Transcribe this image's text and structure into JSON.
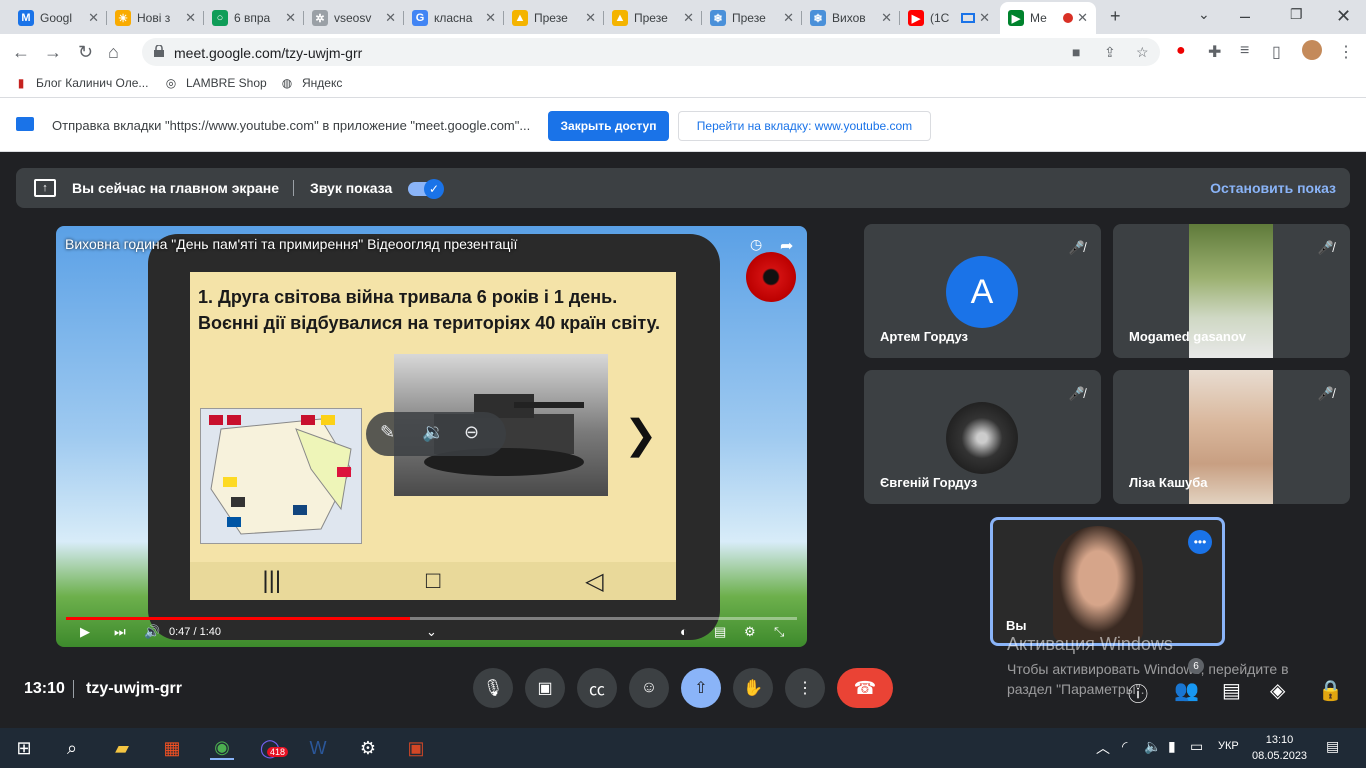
{
  "browser": {
    "tabs": [
      {
        "label": "Googl",
        "color": "#1a73e8",
        "icon": "gmail-icon",
        "glyph": "M"
      },
      {
        "label": "Нові з",
        "color": "#f9ab00",
        "icon": "sun-icon",
        "glyph": "☀"
      },
      {
        "label": "6 впра",
        "color": "#0f9d58",
        "icon": "circle-icon",
        "glyph": "○"
      },
      {
        "label": "vseosv",
        "color": "#9aa0a6",
        "icon": "star-icon",
        "glyph": "✲"
      },
      {
        "label": "класна",
        "color": "#4285f4",
        "icon": "google-icon",
        "glyph": "G"
      },
      {
        "label": "Презе",
        "color": "#f4b400",
        "icon": "slides-icon",
        "glyph": "▲"
      },
      {
        "label": "Презе",
        "color": "#f4b400",
        "icon": "slides-icon",
        "glyph": "▲"
      },
      {
        "label": "Презе",
        "color": "#4a90d9",
        "icon": "snowflake-icon",
        "glyph": "❄"
      },
      {
        "label": "Вихов",
        "color": "#4a90d9",
        "icon": "snowflake-icon",
        "glyph": "❄"
      },
      {
        "label": "(1С",
        "color": "#ff0000",
        "icon": "youtube-icon",
        "glyph": "▶"
      },
      {
        "label": "Ме",
        "color": "#00832d",
        "icon": "meet-icon",
        "glyph": "▶"
      }
    ],
    "url": "meet.google.com/tzy-uwjm-grr",
    "bookmarks": [
      {
        "label": "Блог Калинич Оле...",
        "icon": "bookmark-icon"
      },
      {
        "label": "LAMBRE Shop",
        "icon": "lambre-icon"
      },
      {
        "label": "Яндекс",
        "icon": "globe-icon"
      }
    ],
    "infobar": {
      "text": "Отправка вкладки \"https://www.youtube.com\" в приложение \"meet.google.com\"...",
      "stop_label": "Закрыть доступ",
      "goto_label": "Перейти на вкладку: www.youtube.com"
    }
  },
  "meet": {
    "presenting_text": "Вы сейчас на главном экране",
    "sound_label": "Звук показа",
    "stop_label": "Остановить показ",
    "video": {
      "title": "Виховна година \"День пам'яті та примирення\" Відеоогляд презентації",
      "slide_text": "1. Друга світова війна тривала 6 років і 1 день. Воєнні дії відбувалися на територіях 40 країн світу.",
      "time": "0:47 / 1:40",
      "progress": 0.47
    },
    "participants": [
      {
        "name": "Артем Гордуз",
        "avatar": "A",
        "avatar_color": "#1a73e8"
      },
      {
        "name": "Mogamed gasanov",
        "avatar": "",
        "avatar_color": ""
      },
      {
        "name": "Євгеній Гордуз",
        "avatar": "",
        "avatar_color": "#444"
      },
      {
        "name": "Ліза Кашуба",
        "avatar": "",
        "avatar_color": ""
      }
    ],
    "self_name": "Вы",
    "watermark_title": "Активация Windows",
    "watermark_text": "Чтобы активировать Windows, перейдите в раздел \"Параметры\".",
    "bottom": {
      "time": "13:10",
      "code": "tzy-uwjm-grr",
      "people_count": "6"
    }
  },
  "taskbar": {
    "lang": "УКР",
    "time": "13:10",
    "date": "08.05.2023",
    "viber_badge": "418"
  }
}
